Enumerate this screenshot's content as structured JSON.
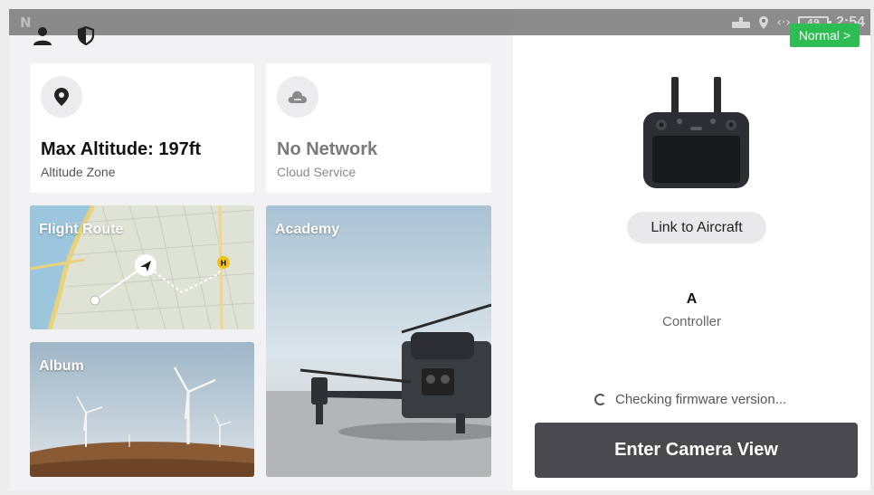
{
  "status_bar": {
    "time": "2:54",
    "battery": "49",
    "mode_badge": "Normal >"
  },
  "cards": {
    "altitude": {
      "title": "Max Altitude: 197ft",
      "subtitle": "Altitude Zone",
      "icon": "location-pin-icon"
    },
    "cloud": {
      "title": "No Network",
      "subtitle": "Cloud Service",
      "icon": "cloud-icon"
    }
  },
  "tiles": {
    "flight_route": "Flight Route",
    "academy": "Academy",
    "album": "Album"
  },
  "controller": {
    "link_button": "Link to Aircraft",
    "name": "A",
    "label": "Controller",
    "firmware_status": "Checking firmware version...",
    "enter_button": "Enter Camera View"
  },
  "colors": {
    "accent_green": "#2ebd53",
    "primary_button": "#4a4a4e",
    "route_yellow": "#f2c21c"
  }
}
